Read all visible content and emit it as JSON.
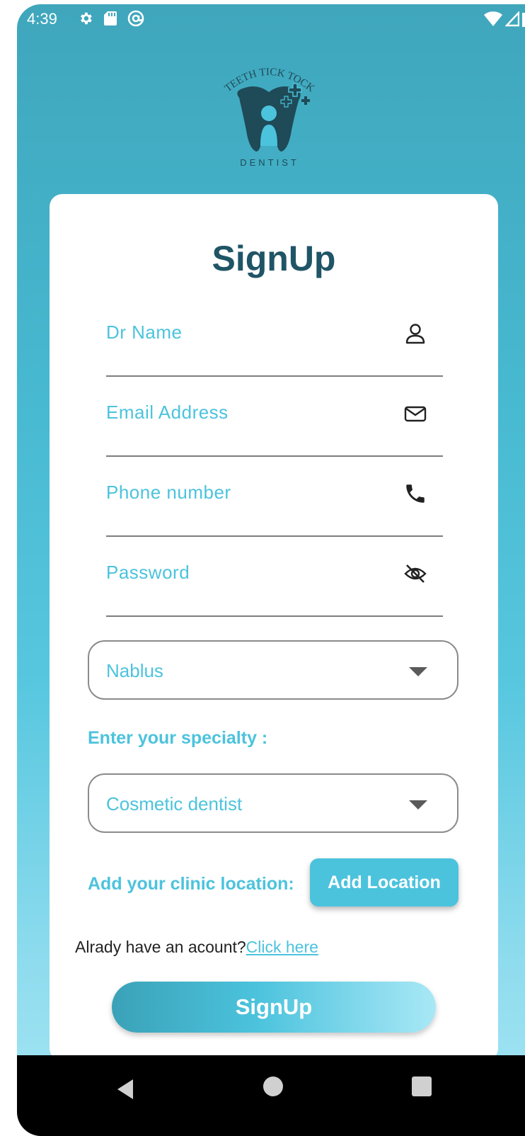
{
  "status_bar": {
    "time": "4:39",
    "left_icons": [
      "gear-icon",
      "sd-card-icon",
      "at-sign-icon"
    ],
    "right_icons": [
      "wifi-icon",
      "signal-icon",
      "battery-icon"
    ]
  },
  "logo": {
    "arc_text": "TEETH TICK TOCK",
    "bottom_text": "DENTIST"
  },
  "form": {
    "title": "SignUp",
    "fields": [
      {
        "label": "Dr Name",
        "icon": "person-icon"
      },
      {
        "label": "Email Address",
        "icon": "mail-icon"
      },
      {
        "label": "Phone number",
        "icon": "phone-icon"
      },
      {
        "label": "Password",
        "icon": "eye-off-icon"
      }
    ],
    "city_select": {
      "value": "Nablus"
    },
    "specialty_label": "Enter your specialty :",
    "specialty_select": {
      "value": "Cosmetic dentist"
    },
    "clinic_location_label": "Add your clinic location:",
    "add_location_button": "Add Location",
    "already_text": "Alrady have an acount?",
    "click_here_link": "Click here",
    "signup_button": "SignUp"
  },
  "colors": {
    "accent": "#4cc3dd",
    "title": "#1f5566",
    "background_top": "#3fa6bc",
    "background_bottom": "#a6e6f5"
  }
}
